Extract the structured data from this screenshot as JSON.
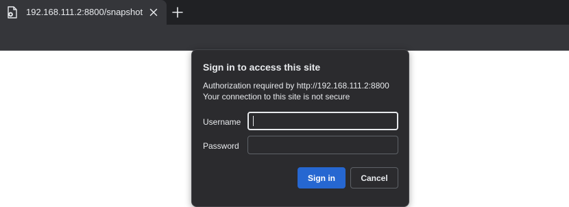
{
  "browser": {
    "tab": {
      "title": "192.168.111.2:8800/snapshot",
      "favicon_icon": "page-icon",
      "close_icon": "close-icon"
    },
    "new_tab_icon": "plus-icon"
  },
  "dialog": {
    "title": "Sign in to access this site",
    "authorization_line": "Authorization required by http://192.168.111.2:8800",
    "security_line": "Your connection to this site is not secure",
    "username_label": "Username",
    "username_value": "",
    "password_label": "Password",
    "password_value": "",
    "signin_label": "Sign in",
    "cancel_label": "Cancel"
  },
  "colors": {
    "primary_button": "#2667d1",
    "dialog_background": "#2b2b2e",
    "tab_background": "#35363a",
    "tabstrip_background": "#202124"
  }
}
